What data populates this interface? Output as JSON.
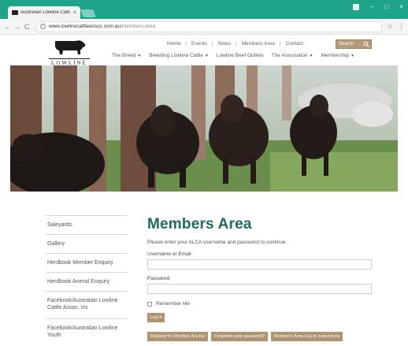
{
  "browser": {
    "tab_title": "Australian Lowline Cattl",
    "tab_close": "×",
    "url_host": "www.lowlinecattleassoc.com.au",
    "url_path": "/members-area",
    "back": "←",
    "forward": "→",
    "reload": "C",
    "star": "☆",
    "menu": "⋮",
    "minimize": "–",
    "maximize": "□",
    "close": "×",
    "theme_color": "#1fa48a"
  },
  "site": {
    "logo_text": "LOWLINE",
    "top_nav": [
      "Home",
      "Events",
      "News",
      "Members Area",
      "Contact"
    ],
    "search_placeholder": "Search",
    "main_nav": [
      {
        "label": "The Breed",
        "dropdown": true
      },
      {
        "label": "Breeding Lowline Cattle",
        "dropdown": true
      },
      {
        "label": "Lowline Beef Outlets",
        "dropdown": false
      },
      {
        "label": "The Association",
        "dropdown": true
      },
      {
        "label": "Membership",
        "dropdown": true
      }
    ],
    "caret": "▼"
  },
  "sidebar": {
    "items": [
      {
        "label": "Saleyards"
      },
      {
        "label": "Gallery"
      },
      {
        "label": "Herdbook Member Enquiry"
      },
      {
        "label": "Herdbook Animal Enquiry"
      },
      {
        "label": "Facebook/Australian Lowline Cattle Assoc. Inc"
      },
      {
        "label": "Facebook/Australian Lowline Youth"
      }
    ]
  },
  "main": {
    "title": "Members Area",
    "intro": "Please enter your ALCA username and password to continue.",
    "username_label": "Username or Email",
    "password_label": "Password",
    "remember_label": "Remember Me",
    "login_button": "Log In",
    "buttons": [
      "Register for Member Access",
      "Forgotten your password?",
      "Members' Area Log-in Instructions"
    ]
  },
  "colors": {
    "title_green": "#1f6b5c",
    "button_brown": "#b09472"
  }
}
